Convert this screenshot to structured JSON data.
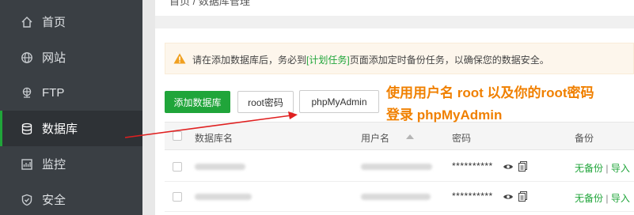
{
  "sidebar": {
    "items": [
      {
        "label": "首页",
        "icon": "home-icon"
      },
      {
        "label": "网站",
        "icon": "globe-icon"
      },
      {
        "label": "FTP",
        "icon": "ftp-icon"
      },
      {
        "label": "数据库",
        "icon": "database-icon",
        "active": true
      },
      {
        "label": "监控",
        "icon": "monitor-icon"
      },
      {
        "label": "安全",
        "icon": "shield-icon"
      }
    ]
  },
  "breadcrumb": {
    "text": "首页 / 数据库管理"
  },
  "notice": {
    "before": "请在添加数据库后，务必到",
    "link": "[计划任务]",
    "after": "页面添加定时备份任务，以确保您的数据安全。"
  },
  "toolbar": {
    "add_db": "添加数据库",
    "root_pw": "root密码",
    "phpmyadmin": "phpMyAdmin"
  },
  "annotation": {
    "line1": "使用用户名 root 以及你的root密码",
    "line2": "登录 phpMyAdmin"
  },
  "table": {
    "headers": {
      "name": "数据库名",
      "user": "用户名",
      "password": "密码",
      "backup": "备份"
    },
    "rows": [
      {
        "password": "**********",
        "backup_status": "无备份",
        "import": "导入"
      },
      {
        "password": "**********",
        "backup_status": "无备份",
        "import": "导入"
      }
    ]
  },
  "colors": {
    "accent": "#20a53a",
    "annotation": "#f08000",
    "arrow": "#e02020",
    "sidebar": "#3a3f44"
  }
}
